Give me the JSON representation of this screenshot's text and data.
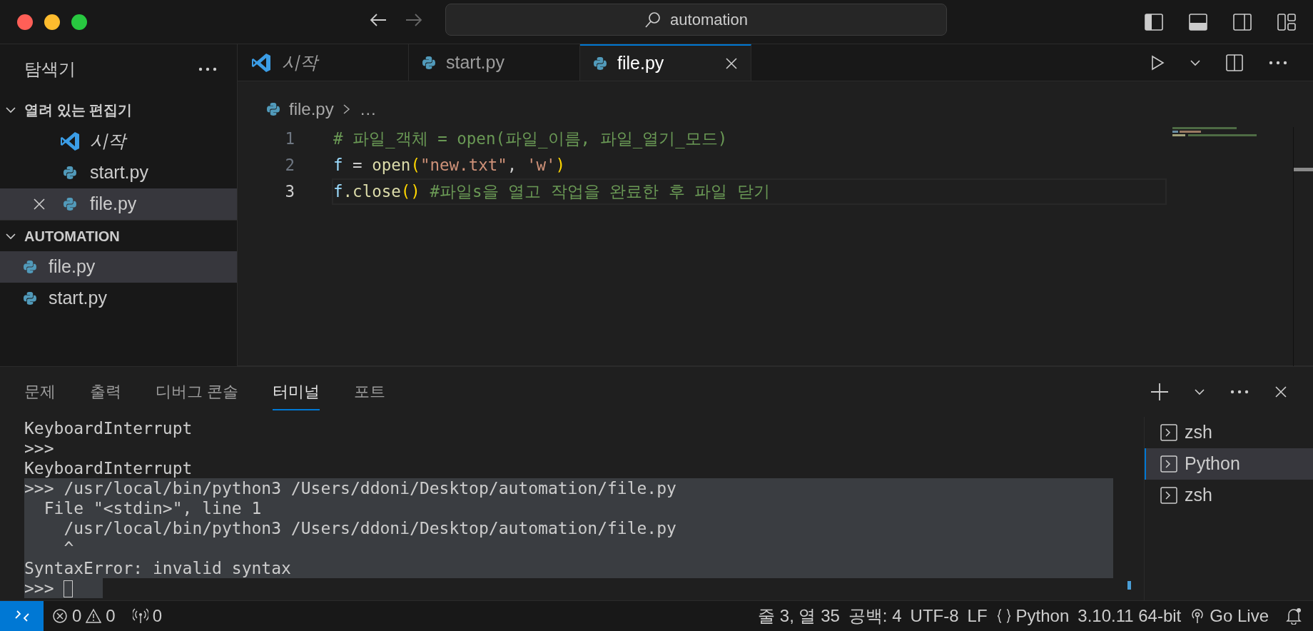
{
  "window": {
    "title": "automation"
  },
  "sidebar": {
    "title": "탐색기",
    "sections": [
      {
        "title": "열려 있는 편집기",
        "expanded": true,
        "items": [
          {
            "label": "시작",
            "kind": "welcome",
            "preview": true,
            "selected": false
          },
          {
            "label": "start.py",
            "kind": "python",
            "preview": false,
            "selected": false
          },
          {
            "label": "file.py",
            "kind": "python",
            "preview": false,
            "selected": true
          }
        ]
      },
      {
        "title": "AUTOMATION",
        "expanded": true,
        "items": [
          {
            "label": "file.py",
            "kind": "python",
            "preview": false,
            "selected": true
          },
          {
            "label": "start.py",
            "kind": "python",
            "preview": false,
            "selected": false
          }
        ]
      }
    ]
  },
  "tabs": [
    {
      "label": "시작",
      "kind": "welcome",
      "preview": true,
      "selected": false
    },
    {
      "label": "start.py",
      "kind": "python",
      "preview": false,
      "selected": false
    },
    {
      "label": "file.py",
      "kind": "python",
      "preview": false,
      "selected": true
    }
  ],
  "breadcrumb": [
    "file.py",
    "…"
  ],
  "code_lines": [
    {
      "number": "1",
      "current": false,
      "tokens": [
        {
          "text": "# 파일_객체 = open(파일_이름, 파일_열기_모드)",
          "kind": "comment"
        }
      ]
    },
    {
      "number": "2",
      "current": false,
      "tokens": [
        {
          "text": "f",
          "kind": "variable"
        },
        {
          "text": " = ",
          "kind": "operator"
        },
        {
          "text": "open",
          "kind": "function"
        },
        {
          "text": "(",
          "kind": "bracket"
        },
        {
          "text": "\"new.txt\"",
          "kind": "string"
        },
        {
          "text": ", ",
          "kind": "operator"
        },
        {
          "text": "'w'",
          "kind": "string"
        },
        {
          "text": ")",
          "kind": "bracket"
        }
      ]
    },
    {
      "number": "3",
      "current": true,
      "tokens": [
        {
          "text": "f",
          "kind": "variable"
        },
        {
          "text": ".close",
          "kind": "function"
        },
        {
          "text": "()",
          "kind": "bracket"
        },
        {
          "text": " #파일s을 열고 작업을 완료한 후 파일 닫기",
          "kind": "comment"
        }
      ]
    }
  ],
  "panel": {
    "tabs": [
      {
        "label": "문제",
        "selected": false
      },
      {
        "label": "출력",
        "selected": false
      },
      {
        "label": "디버그 콘솔",
        "selected": false
      },
      {
        "label": "터미널",
        "selected": true
      },
      {
        "label": "포트",
        "selected": false
      }
    ],
    "terminal_lines": [
      {
        "text": "KeyboardInterrupt",
        "highlighted": false,
        "kind": "output"
      },
      {
        "text": ">>>",
        "highlighted": false,
        "kind": "output"
      },
      {
        "text": "KeyboardInterrupt",
        "highlighted": false,
        "kind": "output"
      },
      {
        "text": ">>> /usr/local/bin/python3 /Users/ddoni/Desktop/automation/file.py",
        "highlighted": true,
        "kind": "output"
      },
      {
        "text": "  File \"<stdin>\", line 1",
        "highlighted": true,
        "kind": "output"
      },
      {
        "text": "    /usr/local/bin/python3 /Users/ddoni/Desktop/automation/file.py",
        "highlighted": true,
        "kind": "output"
      },
      {
        "text": "    ^",
        "highlighted": true,
        "kind": "output"
      },
      {
        "text": "SyntaxError: invalid syntax",
        "highlighted": true,
        "kind": "output"
      },
      {
        "text": ">>>",
        "highlighted": true,
        "kind": "prompt"
      }
    ],
    "terminals": [
      {
        "label": "zsh",
        "selected": false
      },
      {
        "label": "Python",
        "selected": true
      },
      {
        "label": "zsh",
        "selected": false
      }
    ]
  },
  "status_bar": {
    "errors": "0",
    "warnings": "0",
    "ports": "0",
    "cursor": "줄 3, 열 35",
    "indent": "공백: 4",
    "encoding": "UTF-8",
    "eol": "LF",
    "language": "Python",
    "interpreter": "3.10.11 64-bit",
    "live": "Go Live"
  }
}
